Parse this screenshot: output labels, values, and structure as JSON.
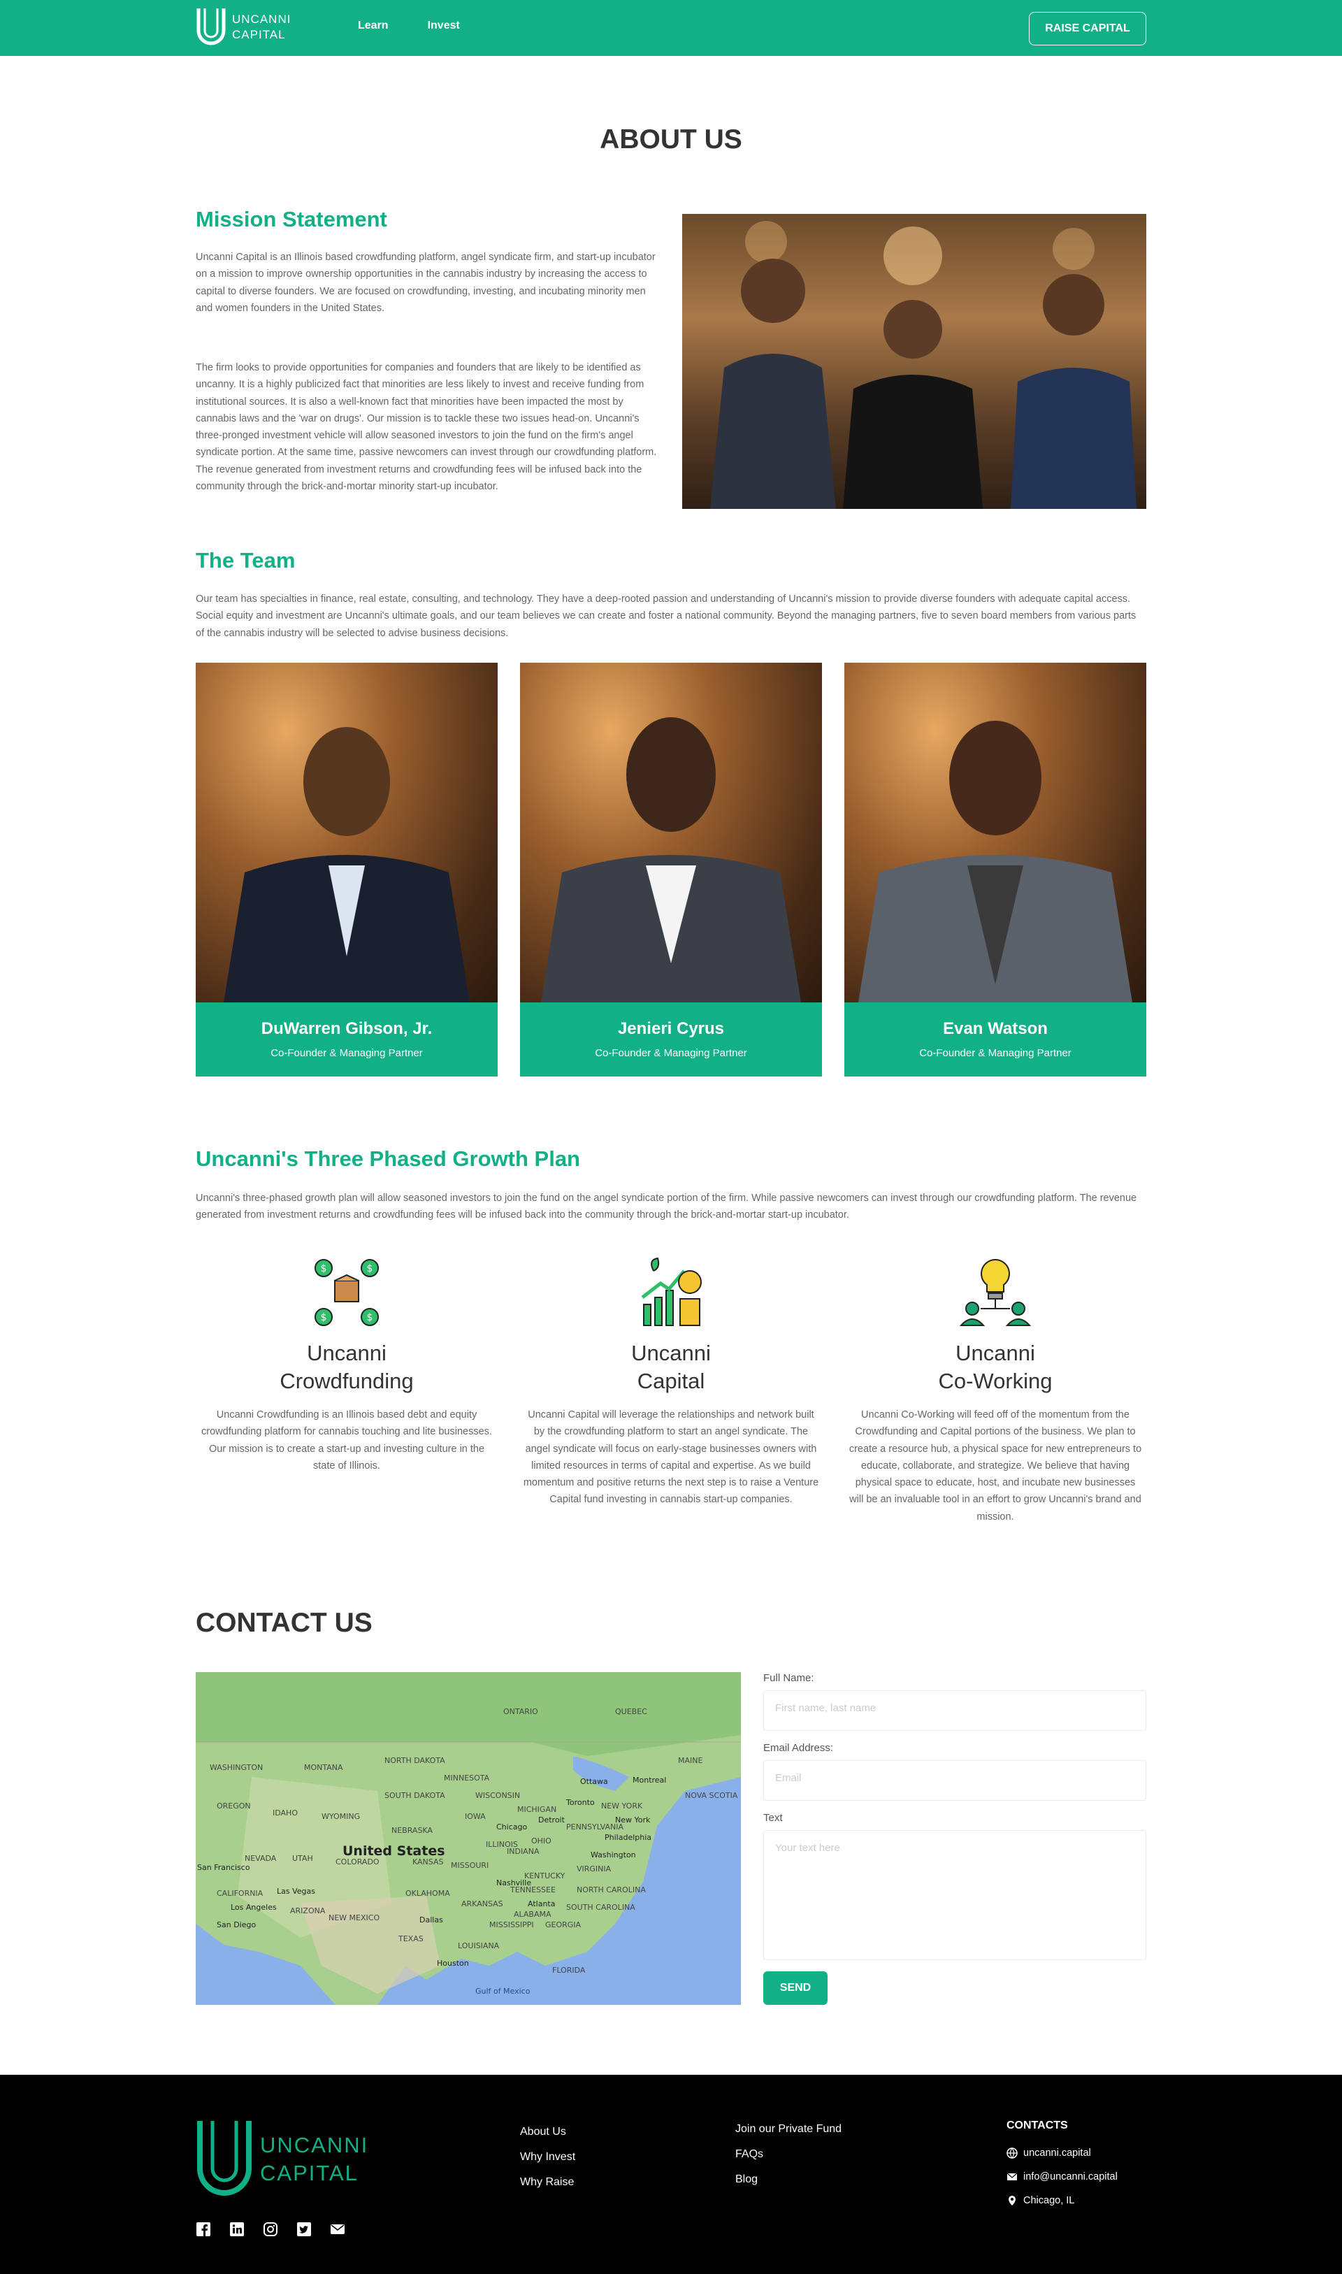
{
  "header": {
    "logo_text_line1": "UNCANNI",
    "logo_text_line2": "CAPITAL",
    "nav": [
      "Learn",
      "Invest"
    ],
    "cta": "RAISE CAPITAL"
  },
  "page_title": "ABOUT US",
  "mission": {
    "heading": "Mission Statement",
    "p1": "Uncanni Capital is an Illinois based crowdfunding platform, angel syndicate firm, and start-up incubator on a mission to improve ownership opportunities in the cannabis industry by increasing the access to capital to diverse founders. We are focused on crowdfunding, investing, and incubating minority men and women founders in the United States.",
    "p2": "The firm looks to provide opportunities for companies and founders that are likely to be identified as uncanny. It is a highly publicized fact that minorities are less likely to invest and receive funding from institutional sources. It is also a well-known fact that minorities have been impacted the most by cannabis laws and the 'war on drugs'. Our mission is to tackle these two issues head-on. Uncanni's three-pronged investment vehicle will allow seasoned investors to join the fund on the firm's angel syndicate portion. At the same time, passive newcomers can invest through our crowdfunding platform. The revenue generated from investment returns and crowdfunding fees will be infused back into the community through the brick-and-mortar minority start-up incubator."
  },
  "team": {
    "heading": "The Team",
    "intro": "Our team has specialties in finance, real estate, consulting, and technology. They have a deep-rooted passion and understanding of Uncanni's mission to provide diverse founders with adequate capital access. Social equity and investment are Uncanni's ultimate goals, and our team believes we can create and foster a national community. Beyond the managing partners, five to seven board members from various parts of the cannabis industry will be selected to advise business decisions.",
    "members": [
      {
        "name": "DuWarren Gibson, Jr.",
        "role": "Co-Founder & Managing Partner"
      },
      {
        "name": "Jenieri Cyrus",
        "role": "Co-Founder & Managing Partner"
      },
      {
        "name": "Evan Watson",
        "role": "Co-Founder & Managing Partner"
      }
    ]
  },
  "growth": {
    "heading": "Uncanni's Three Phased Growth Plan",
    "intro": "Uncanni's three-phased growth plan will allow seasoned investors to join the fund on the angel syndicate portion of the firm. While passive newcomers can invest through our crowdfunding platform. The revenue generated from investment returns and crowdfunding fees will be infused back into the community through the brick-and-mortar start-up incubator.",
    "plans": [
      {
        "title_line1": "Uncanni",
        "title_line2": "Crowdfunding",
        "icon": "crowdfunding-icon",
        "desc": "Uncanni Crowdfunding is an Illinois based debt and equity crowdfunding platform for cannabis touching and lite businesses. Our mission is to create a start-up and investing culture in the state of Illinois."
      },
      {
        "title_line1": "Uncanni",
        "title_line2": "Capital",
        "icon": "capital-growth-icon",
        "desc": "Uncanni Capital will leverage the relationships and network built by the crowdfunding platform to start an angel syndicate. The angel syndicate will focus on early-stage businesses owners with limited resources in terms of capital and expertise. As we build momentum and positive returns the next step is to raise a Venture Capital fund investing in cannabis start-up companies."
      },
      {
        "title_line1": "Uncanni",
        "title_line2": "Co-Working",
        "icon": "coworking-idea-icon",
        "desc": "Uncanni Co-Working will feed off of the momentum from the Crowdfunding and Capital portions of the business. We plan to create a resource hub, a physical space for new entrepreneurs to educate, collaborate, and strategize. We believe that having physical space to educate, host, and incubate new businesses will be an invaluable tool in an effort to grow Uncanni's brand and mission."
      }
    ]
  },
  "contact": {
    "heading": "CONTACT US",
    "map_country_label": "United States",
    "map_labels": [
      "WASHINGTON",
      "MONTANA",
      "NORTH DAKOTA",
      "MINNESOTA",
      "OREGON",
      "IDAHO",
      "SOUTH DAKOTA",
      "WYOMING",
      "NEBRASKA",
      "NEVADA",
      "UTAH",
      "COLORADO",
      "KANSAS",
      "CALIFORNIA",
      "ARIZONA",
      "NEW MEXICO",
      "OKLAHOMA",
      "TEXAS",
      "MISSOURI",
      "IOWA",
      "ILLINOIS",
      "INDIANA",
      "OHIO",
      "MICHIGAN",
      "WISCONSIN",
      "KENTUCKY",
      "TENNESSEE",
      "ARKANSAS",
      "MISSISSIPPI",
      "ALABAMA",
      "GEORGIA",
      "SOUTH CAROLINA",
      "NORTH CAROLINA",
      "VIRGINIA",
      "PENNSYLVANIA",
      "NEW YORK",
      "FLORIDA",
      "LOUISIANA",
      "ONTARIO",
      "QUEBEC",
      "MAINE",
      "NOVA SCOTIA",
      "Ottawa",
      "Montreal",
      "Toronto",
      "Chicago",
      "Detroit",
      "New York",
      "Philadelphia",
      "Washington",
      "Las Vegas",
      "Los Angeles",
      "San Diego",
      "San Francisco",
      "Dallas",
      "Houston",
      "Atlanta",
      "Nashville",
      "Gulf of Mexico"
    ],
    "labels": {
      "name": "Full Name:",
      "email": "Email Address:",
      "text": "Text"
    },
    "placeholders": {
      "name": "First name, last name",
      "email": "Email",
      "text": "Your text here"
    },
    "send": "SEND"
  },
  "footer": {
    "logo_line1": "UNCANNI",
    "logo_line2": "CAPITAL",
    "col1": [
      "About Us",
      "Why Invest",
      "Why Raise"
    ],
    "col2": [
      "Join our Private Fund",
      "FAQs",
      "Blog"
    ],
    "contacts_heading": "CONTACTS",
    "contacts": {
      "website": "uncanni.capital",
      "email": "info@uncanni.capital",
      "location": "Chicago, IL"
    },
    "social": [
      "facebook-icon",
      "linkedin-icon",
      "instagram-icon",
      "twitter-icon",
      "mail-icon"
    ]
  },
  "colors": {
    "brand_green": "#12b087",
    "footer_bg": "#000000",
    "heading_dark": "#333333"
  }
}
